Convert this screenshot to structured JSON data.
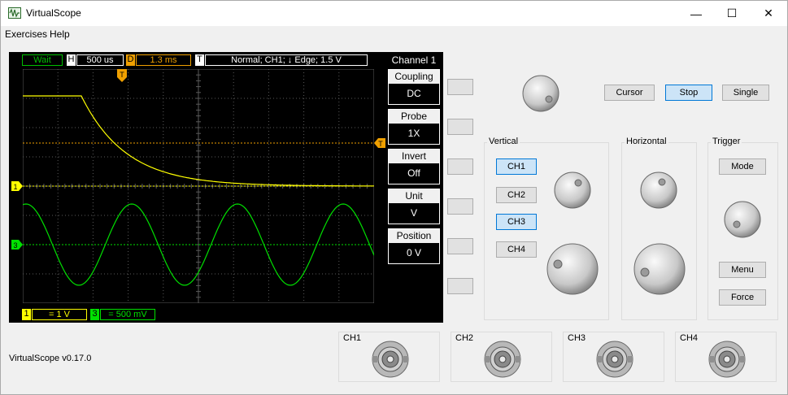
{
  "window": {
    "title": "VirtualScope",
    "minimize": "—",
    "maximize": "☐",
    "close": "✕"
  },
  "menu": {
    "items": [
      "Exercises",
      "Help"
    ]
  },
  "scope": {
    "status": {
      "label": "Wait",
      "color": "#00c000"
    },
    "horizontal": {
      "key": "H",
      "value": "500 us"
    },
    "delay": {
      "key": "D",
      "value": "1.3 ms",
      "color": "#f0a000"
    },
    "trigger": {
      "key": "T",
      "value": "Normal; CH1; ↓ Edge; 1.5 V"
    },
    "channel_title": "Channel 1",
    "params": [
      {
        "label": "Coupling",
        "value": "DC"
      },
      {
        "label": "Probe",
        "value": "1X"
      },
      {
        "label": "Invert",
        "value": "Off"
      },
      {
        "label": "Unit",
        "value": "V"
      },
      {
        "label": "Position",
        "value": "0 V"
      }
    ],
    "ch1_scale": {
      "num": "1",
      "value": "= 1 V",
      "color": "#ffff00"
    },
    "ch3_scale": {
      "num": "3",
      "value": "= 500 mV",
      "color": "#00e000"
    },
    "markers": {
      "trigger_top": "T",
      "trigger_right": "T",
      "ch1": "1",
      "ch3": "3"
    }
  },
  "controls": {
    "cursor": "Cursor",
    "stop": "Stop",
    "single": "Single",
    "vertical": {
      "label": "Vertical",
      "channels": [
        "CH1",
        "CH2",
        "CH3",
        "CH4"
      ]
    },
    "horizontal": {
      "label": "Horizontal"
    },
    "trigger": {
      "label": "Trigger",
      "mode": "Mode",
      "menu": "Menu",
      "force": "Force"
    }
  },
  "inputs": [
    "CH1",
    "CH2",
    "CH3",
    "CH4"
  ],
  "version": "VirtualScope v0.17.0",
  "colors": {
    "ch1": "#ffff00",
    "ch3": "#00e000",
    "trigger": "#f0a000",
    "grid": "#5a5a5a",
    "active_button": "#cce4f7"
  }
}
